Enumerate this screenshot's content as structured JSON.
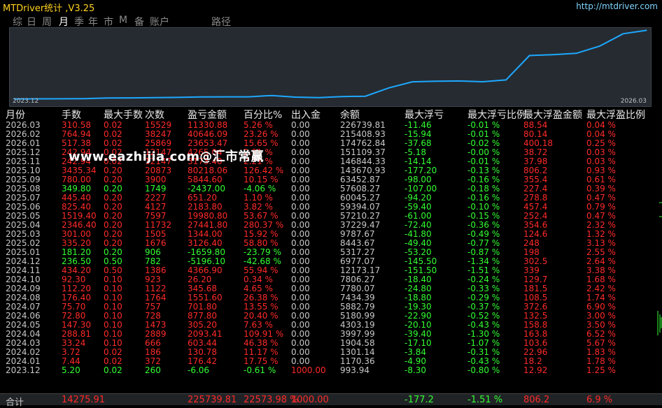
{
  "app": {
    "title": "MTDriver统计 ,V3.25",
    "url": "http://mtdriver.com"
  },
  "tabs": [
    {
      "label": "综",
      "active": false
    },
    {
      "label": "日",
      "active": false
    },
    {
      "label": "周",
      "active": false
    },
    {
      "label": "月",
      "active": true
    },
    {
      "label": "季",
      "active": false
    },
    {
      "label": "年",
      "active": false
    },
    {
      "label": "市",
      "active": false
    },
    {
      "label": "M",
      "active": false
    },
    {
      "label": "备",
      "active": false
    },
    {
      "label": "账户",
      "active": false
    },
    {
      "label": "路径",
      "active": false
    }
  ],
  "chart": {
    "x_start": "2023.12",
    "x_end": "2026.03",
    "line_color": "#1ea8ff",
    "chart_data": {
      "type": "line",
      "x": [
        "2023.12",
        "2024.01",
        "2024.02",
        "2024.03",
        "2024.04",
        "2024.05",
        "2024.06",
        "2024.07",
        "2024.08",
        "2024.09",
        "2024.10",
        "2024.11",
        "2024.12",
        "2025.01",
        "2025.02",
        "2025.03",
        "2025.04",
        "2025.05",
        "2025.06",
        "2025.07",
        "2025.08",
        "2025.09",
        "2025.10",
        "2025.11",
        "2025.12",
        "2026.01",
        "2026.02",
        "2026.03"
      ],
      "y": [
        993.94,
        1170.36,
        1301.14,
        1904.58,
        3997.99,
        4303.19,
        5180.99,
        5882.79,
        7434.39,
        7780.07,
        7806.27,
        12173.17,
        6977.07,
        5317.27,
        8443.67,
        9787.67,
        37229.47,
        57210.27,
        59394.07,
        60045.27,
        57608.27,
        63452.87,
        143670.93,
        146844.33,
        151109.37,
        174762.84,
        215408.93,
        226739.81
      ]
    }
  },
  "table": {
    "headers": [
      "月份",
      "手数",
      "最大手数",
      "次数",
      "盈亏金额",
      "百分比%",
      "出入金",
      "余额",
      "最大浮亏",
      "最大浮亏比例",
      "最大浮盈金额",
      "最大浮盈比例"
    ],
    "rows": [
      [
        "2026.03",
        "310.58",
        "0.02",
        "15529",
        "11330.88",
        "5.26 %",
        "0.00",
        "226739.81",
        "-11.46",
        "-0.01 %",
        "88.54",
        "0.04 %"
      ],
      [
        "2026.02",
        "764.94",
        "0.02",
        "38247",
        "40646.09",
        "23.26 %",
        "0.00",
        "215408.93",
        "-15.94",
        "-0.01 %",
        "80.14",
        "0.04 %"
      ],
      [
        "2026.01",
        "517.38",
        "0.02",
        "25869",
        "23653.47",
        "15.65 %",
        "0.00",
        "174762.84",
        "-37.68",
        "-0.02 %",
        "400.18",
        "0.25 %"
      ],
      [
        "2025.12",
        "242.94",
        "0.02",
        "12147",
        "4265.04",
        "2.91 %",
        "0.00",
        "151109.37",
        "-5.18",
        "-0.00 %",
        "38.72",
        "0.03 %"
      ],
      [
        "2025.11",
        "242.94",
        "0.02",
        "12147",
        "3173.40",
        "2.21 %",
        "0.00",
        "146844.33",
        "-14.14",
        "-0.01 %",
        "37.98",
        "0.03 %"
      ],
      [
        "2025.10",
        "3435.34",
        "0.20",
        "20873",
        "80218.06",
        "126.42 %",
        "0.00",
        "143670.93",
        "-177.20",
        "-0.13 %",
        "806.2",
        "0.93 %"
      ],
      [
        "2025.09",
        "780.00",
        "0.20",
        "3900",
        "5844.60",
        "10.15 %",
        "0.00",
        "63452.87",
        "-98.00",
        "-0.16 %",
        "355.4",
        "0.61 %"
      ],
      [
        "2025.08",
        "349.80",
        "0.20",
        "1749",
        "-2437.00",
        "-4.06 %",
        "0.00",
        "57608.27",
        "-107.00",
        "-0.18 %",
        "227.4",
        "0.39 %"
      ],
      [
        "2025.07",
        "445.40",
        "0.20",
        "2227",
        "651.20",
        "1.10 %",
        "0.00",
        "60045.27",
        "-94.20",
        "-0.16 %",
        "278.8",
        "0.47 %"
      ],
      [
        "2025.06",
        "825.40",
        "0.20",
        "4127",
        "2183.80",
        "3.82 %",
        "0.00",
        "59394.07",
        "-59.40",
        "-0.10 %",
        "457.4",
        "0.79 %"
      ],
      [
        "2025.05",
        "1519.40",
        "0.20",
        "7597",
        "19980.80",
        "53.67 %",
        "0.00",
        "57210.27",
        "-61.00",
        "-0.15 %",
        "252.4",
        "0.47 %"
      ],
      [
        "2025.04",
        "2346.40",
        "0.20",
        "11732",
        "27441.80",
        "280.37 %",
        "0.00",
        "37229.47",
        "-72.40",
        "-0.36 %",
        "354.6",
        "2.32 %"
      ],
      [
        "2025.03",
        "301.00",
        "0.20",
        "1505",
        "1344.00",
        "15.92 %",
        "0.00",
        "9787.67",
        "-41.80",
        "-0.49 %",
        "124.6",
        "1.32 %"
      ],
      [
        "2025.02",
        "335.20",
        "0.20",
        "1676",
        "3126.40",
        "58.80 %",
        "0.00",
        "8443.67",
        "-49.40",
        "-0.77 %",
        "248",
        "3.13 %"
      ],
      [
        "2025.01",
        "181.20",
        "0.20",
        "906",
        "-1659.80",
        "-23.79 %",
        "0.00",
        "5317.27",
        "-53.20",
        "-0.87 %",
        "198",
        "2.55 %"
      ],
      [
        "2024.12",
        "236.50",
        "0.50",
        "782",
        "-5196.10",
        "-42.68 %",
        "0.00",
        "6977.07",
        "-145.50",
        "-1.34 %",
        "302.5",
        "2.64 %"
      ],
      [
        "2024.11",
        "434.20",
        "0.50",
        "1386",
        "4366.90",
        "55.94 %",
        "0.00",
        "12173.17",
        "-151.50",
        "-1.51 %",
        "339",
        "3.38 %"
      ],
      [
        "2024.10",
        "92.30",
        "0.10",
        "923",
        "26.20",
        "0.34 %",
        "0.00",
        "7806.27",
        "-18.40",
        "-0.24 %",
        "129.7",
        "1.68 %"
      ],
      [
        "2024.09",
        "112.20",
        "0.10",
        "1122",
        "345.68",
        "4.65 %",
        "0.00",
        "7780.07",
        "-24.80",
        "-0.33 %",
        "181.5",
        "2.42 %"
      ],
      [
        "2024.08",
        "176.40",
        "0.10",
        "1764",
        "1551.60",
        "26.38 %",
        "0.00",
        "7434.39",
        "-18.80",
        "-0.29 %",
        "108.5",
        "1.74 %"
      ],
      [
        "2024.07",
        "75.70",
        "0.10",
        "757",
        "701.80",
        "13.55 %",
        "0.00",
        "5882.79",
        "-19.30",
        "-0.37 %",
        "372.6",
        "6.90 %"
      ],
      [
        "2024.06",
        "72.80",
        "0.10",
        "728",
        "877.80",
        "20.40 %",
        "0.00",
        "5180.99",
        "-22.90",
        "-0.52 %",
        "132.5",
        "3.00 %"
      ],
      [
        "2024.05",
        "147.30",
        "0.10",
        "1473",
        "305.20",
        "7.63 %",
        "0.00",
        "4303.19",
        "-20.10",
        "-0.43 %",
        "158.8",
        "3.50 %"
      ],
      [
        "2024.04",
        "288.81",
        "0.10",
        "2889",
        "2093.41",
        "109.91 %",
        "0.00",
        "3997.99",
        "-39.40",
        "-1.30 %",
        "163.8",
        "6.52 %"
      ],
      [
        "2024.03",
        "33.24",
        "0.10",
        "666",
        "603.44",
        "46.38 %",
        "0.00",
        "1904.58",
        "-17.10",
        "-1.07 %",
        "103.6",
        "5.67 %"
      ],
      [
        "2024.02",
        "3.72",
        "0.02",
        "186",
        "130.78",
        "11.17 %",
        "0.00",
        "1301.14",
        "-3.84",
        "-0.31 %",
        "22.96",
        "1.83 %"
      ],
      [
        "2024.01",
        "7.44",
        "0.02",
        "372",
        "176.42",
        "17.75 %",
        "0.00",
        "1170.36",
        "-4.90",
        "-0.43 %",
        "18.2",
        "1.78 %"
      ],
      [
        "2023.12",
        "5.20",
        "0.02",
        "260",
        "-6.06",
        "-0.61 %",
        "1000.00",
        "993.94",
        "-8.30",
        "-0.80 %",
        "12.92",
        "1.25 %"
      ]
    ],
    "totals": [
      "合计",
      "14275.91",
      "",
      "",
      "225739.81",
      "22573.98 %",
      "1000.00",
      "",
      "-177.2",
      "-1.51 %",
      "806.2",
      "6.9 %"
    ]
  },
  "watermark": "www.eazhijia.com@汇市常赢",
  "colors": {
    "positive": "#ff2a2a",
    "negative": "#33ff33",
    "neutral": "#c8c8c8",
    "accent": "#ffd21f"
  }
}
